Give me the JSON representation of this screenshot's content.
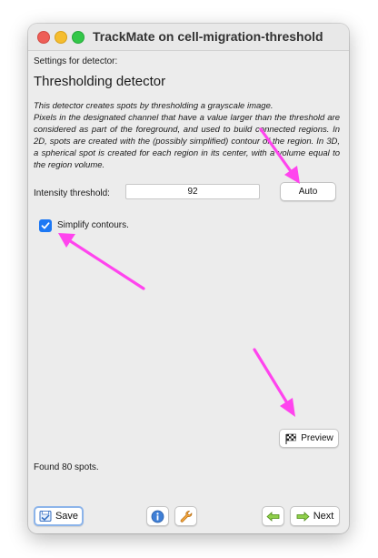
{
  "window": {
    "title": "TrackMate on cell-migration-threshold"
  },
  "detector": {
    "settings_label": "Settings for detector:",
    "heading": "Thresholding detector",
    "description": [
      "This detector creates spots by thresholding a grayscale image.",
      "Pixels in the designated channel that have a value larger than the threshold are considered as part of the foreground, and used to build connected regions. In 2D, spots are created with the (possibly simplified) contour of the region. In 3D, a spherical spot is created for each region in its center, with a volume equal to the region volume."
    ],
    "threshold_label": "Intensity threshold:",
    "threshold_value": "92",
    "auto_label": "Auto",
    "simplify_label": "Simplify contours.",
    "simplify_checked": true,
    "preview_label": "Preview",
    "found_text": "Found 80 spots."
  },
  "footer": {
    "save_label": "Save",
    "next_label": "Next"
  },
  "colors": {
    "annotation_arrow": "#ff44ee",
    "checkbox": "#1d78f4"
  },
  "icons": [
    "info-icon",
    "wrench-icon",
    "back-arrow-icon",
    "next-arrow-icon",
    "floppy-icon",
    "checkered-flag-icon"
  ]
}
